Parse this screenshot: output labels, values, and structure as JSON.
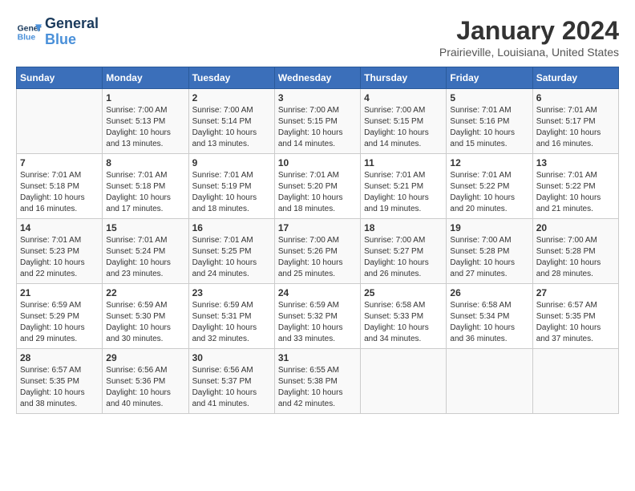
{
  "header": {
    "logo_line1": "General",
    "logo_line2": "Blue",
    "month_title": "January 2024",
    "location": "Prairieville, Louisiana, United States"
  },
  "days_of_week": [
    "Sunday",
    "Monday",
    "Tuesday",
    "Wednesday",
    "Thursday",
    "Friday",
    "Saturday"
  ],
  "weeks": [
    [
      {
        "num": "",
        "sunrise": "",
        "sunset": "",
        "daylight": ""
      },
      {
        "num": "1",
        "sunrise": "Sunrise: 7:00 AM",
        "sunset": "Sunset: 5:13 PM",
        "daylight": "Daylight: 10 hours and 13 minutes."
      },
      {
        "num": "2",
        "sunrise": "Sunrise: 7:00 AM",
        "sunset": "Sunset: 5:14 PM",
        "daylight": "Daylight: 10 hours and 13 minutes."
      },
      {
        "num": "3",
        "sunrise": "Sunrise: 7:00 AM",
        "sunset": "Sunset: 5:15 PM",
        "daylight": "Daylight: 10 hours and 14 minutes."
      },
      {
        "num": "4",
        "sunrise": "Sunrise: 7:00 AM",
        "sunset": "Sunset: 5:15 PM",
        "daylight": "Daylight: 10 hours and 14 minutes."
      },
      {
        "num": "5",
        "sunrise": "Sunrise: 7:01 AM",
        "sunset": "Sunset: 5:16 PM",
        "daylight": "Daylight: 10 hours and 15 minutes."
      },
      {
        "num": "6",
        "sunrise": "Sunrise: 7:01 AM",
        "sunset": "Sunset: 5:17 PM",
        "daylight": "Daylight: 10 hours and 16 minutes."
      }
    ],
    [
      {
        "num": "7",
        "sunrise": "Sunrise: 7:01 AM",
        "sunset": "Sunset: 5:18 PM",
        "daylight": "Daylight: 10 hours and 16 minutes."
      },
      {
        "num": "8",
        "sunrise": "Sunrise: 7:01 AM",
        "sunset": "Sunset: 5:18 PM",
        "daylight": "Daylight: 10 hours and 17 minutes."
      },
      {
        "num": "9",
        "sunrise": "Sunrise: 7:01 AM",
        "sunset": "Sunset: 5:19 PM",
        "daylight": "Daylight: 10 hours and 18 minutes."
      },
      {
        "num": "10",
        "sunrise": "Sunrise: 7:01 AM",
        "sunset": "Sunset: 5:20 PM",
        "daylight": "Daylight: 10 hours and 18 minutes."
      },
      {
        "num": "11",
        "sunrise": "Sunrise: 7:01 AM",
        "sunset": "Sunset: 5:21 PM",
        "daylight": "Daylight: 10 hours and 19 minutes."
      },
      {
        "num": "12",
        "sunrise": "Sunrise: 7:01 AM",
        "sunset": "Sunset: 5:22 PM",
        "daylight": "Daylight: 10 hours and 20 minutes."
      },
      {
        "num": "13",
        "sunrise": "Sunrise: 7:01 AM",
        "sunset": "Sunset: 5:22 PM",
        "daylight": "Daylight: 10 hours and 21 minutes."
      }
    ],
    [
      {
        "num": "14",
        "sunrise": "Sunrise: 7:01 AM",
        "sunset": "Sunset: 5:23 PM",
        "daylight": "Daylight: 10 hours and 22 minutes."
      },
      {
        "num": "15",
        "sunrise": "Sunrise: 7:01 AM",
        "sunset": "Sunset: 5:24 PM",
        "daylight": "Daylight: 10 hours and 23 minutes."
      },
      {
        "num": "16",
        "sunrise": "Sunrise: 7:01 AM",
        "sunset": "Sunset: 5:25 PM",
        "daylight": "Daylight: 10 hours and 24 minutes."
      },
      {
        "num": "17",
        "sunrise": "Sunrise: 7:00 AM",
        "sunset": "Sunset: 5:26 PM",
        "daylight": "Daylight: 10 hours and 25 minutes."
      },
      {
        "num": "18",
        "sunrise": "Sunrise: 7:00 AM",
        "sunset": "Sunset: 5:27 PM",
        "daylight": "Daylight: 10 hours and 26 minutes."
      },
      {
        "num": "19",
        "sunrise": "Sunrise: 7:00 AM",
        "sunset": "Sunset: 5:28 PM",
        "daylight": "Daylight: 10 hours and 27 minutes."
      },
      {
        "num": "20",
        "sunrise": "Sunrise: 7:00 AM",
        "sunset": "Sunset: 5:28 PM",
        "daylight": "Daylight: 10 hours and 28 minutes."
      }
    ],
    [
      {
        "num": "21",
        "sunrise": "Sunrise: 6:59 AM",
        "sunset": "Sunset: 5:29 PM",
        "daylight": "Daylight: 10 hours and 29 minutes."
      },
      {
        "num": "22",
        "sunrise": "Sunrise: 6:59 AM",
        "sunset": "Sunset: 5:30 PM",
        "daylight": "Daylight: 10 hours and 30 minutes."
      },
      {
        "num": "23",
        "sunrise": "Sunrise: 6:59 AM",
        "sunset": "Sunset: 5:31 PM",
        "daylight": "Daylight: 10 hours and 32 minutes."
      },
      {
        "num": "24",
        "sunrise": "Sunrise: 6:59 AM",
        "sunset": "Sunset: 5:32 PM",
        "daylight": "Daylight: 10 hours and 33 minutes."
      },
      {
        "num": "25",
        "sunrise": "Sunrise: 6:58 AM",
        "sunset": "Sunset: 5:33 PM",
        "daylight": "Daylight: 10 hours and 34 minutes."
      },
      {
        "num": "26",
        "sunrise": "Sunrise: 6:58 AM",
        "sunset": "Sunset: 5:34 PM",
        "daylight": "Daylight: 10 hours and 36 minutes."
      },
      {
        "num": "27",
        "sunrise": "Sunrise: 6:57 AM",
        "sunset": "Sunset: 5:35 PM",
        "daylight": "Daylight: 10 hours and 37 minutes."
      }
    ],
    [
      {
        "num": "28",
        "sunrise": "Sunrise: 6:57 AM",
        "sunset": "Sunset: 5:35 PM",
        "daylight": "Daylight: 10 hours and 38 minutes."
      },
      {
        "num": "29",
        "sunrise": "Sunrise: 6:56 AM",
        "sunset": "Sunset: 5:36 PM",
        "daylight": "Daylight: 10 hours and 40 minutes."
      },
      {
        "num": "30",
        "sunrise": "Sunrise: 6:56 AM",
        "sunset": "Sunset: 5:37 PM",
        "daylight": "Daylight: 10 hours and 41 minutes."
      },
      {
        "num": "31",
        "sunrise": "Sunrise: 6:55 AM",
        "sunset": "Sunset: 5:38 PM",
        "daylight": "Daylight: 10 hours and 42 minutes."
      },
      {
        "num": "",
        "sunrise": "",
        "sunset": "",
        "daylight": ""
      },
      {
        "num": "",
        "sunrise": "",
        "sunset": "",
        "daylight": ""
      },
      {
        "num": "",
        "sunrise": "",
        "sunset": "",
        "daylight": ""
      }
    ]
  ]
}
